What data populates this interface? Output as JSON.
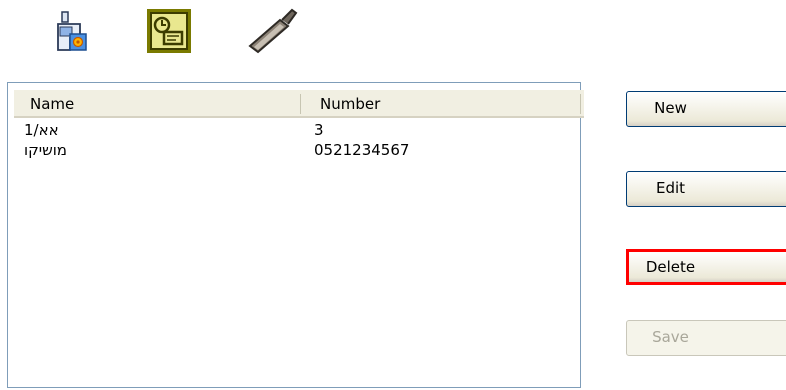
{
  "toolbar": {
    "icons": [
      "phone-settings-icon",
      "contacts-card-icon",
      "mobile-phone-icon"
    ]
  },
  "list": {
    "columns": [
      "Name",
      "Number"
    ],
    "rows": [
      {
        "name": "אא/1",
        "number": "3"
      },
      {
        "name": "מושיקו",
        "number": "0521234567"
      }
    ]
  },
  "buttons": {
    "new": "New",
    "edit": "Edit",
    "delete": "Delete",
    "save": "Save"
  },
  "colors": {
    "highlight": "#ff0000",
    "icon_frame": "#6b6b00"
  }
}
